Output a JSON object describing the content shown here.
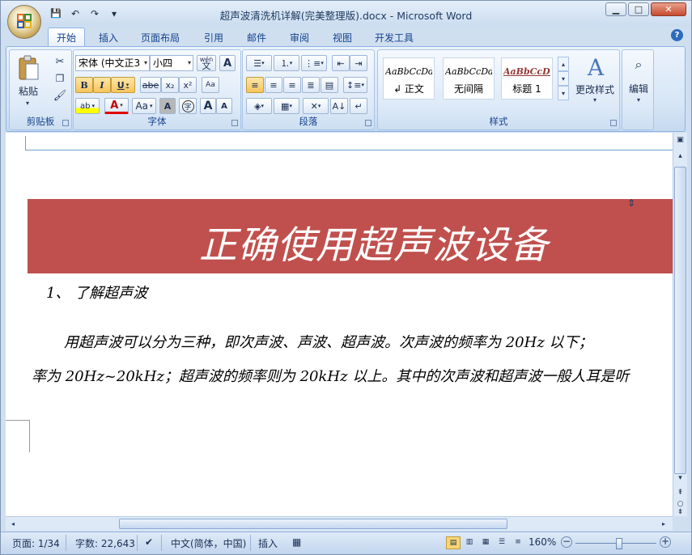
{
  "window": {
    "title": "超声波清洗机详解(完美整理版).docx - Microsoft Word",
    "controls": {
      "minimize": "▁",
      "maximize": "□",
      "close": "✕"
    }
  },
  "quick_access": {
    "save": "💾",
    "undo": "↶",
    "redo": "↷",
    "customize": "▾"
  },
  "tabs": [
    "开始",
    "插入",
    "页面布局",
    "引用",
    "邮件",
    "审阅",
    "视图",
    "开发工具"
  ],
  "help": "?",
  "ribbon": {
    "clipboard": {
      "label": "剪贴板",
      "paste": "粘贴"
    },
    "font": {
      "label": "字体",
      "font_name": "宋体 (中文正3",
      "font_size": "小四",
      "wen": "wén",
      "bold": "B",
      "italic": "I",
      "underline": "U",
      "strike": "abe",
      "sub": "x₂",
      "sup": "x²",
      "clear": "Aa",
      "highlight": "ab",
      "font_color": "A",
      "case": "Aa",
      "shade": "A",
      "circle": "字",
      "grow": "A",
      "shrink": "A"
    },
    "paragraph": {
      "label": "段落"
    },
    "styles": {
      "label": "样式",
      "items": [
        {
          "sample": "AaBbCcDdI",
          "name": "↲ 正文"
        },
        {
          "sample": "AaBbCcDdI",
          "name": "无间隔"
        },
        {
          "sample": "AaBbCcDd",
          "name": "标题 1"
        }
      ],
      "change_styles": "更改样式"
    },
    "editing": {
      "label": "编辑"
    }
  },
  "document": {
    "banner_title": "正确使用超声波设备",
    "heading": "1、  了解超声波",
    "para_line1": "用超声波可以分为三种，即次声波、声波、超声波。次声波的频率为 20Hz 以下；",
    "para_line2": "率为 20Hz~20kHz；超声波的频率则为 20kHz 以上。其中的次声波和超声波一般人耳是听"
  },
  "status": {
    "page": "页面: 1/34",
    "words": "字数: 22,643",
    "language": "中文(简体，中国)",
    "mode": "插入",
    "zoom": "160%"
  },
  "colors": {
    "banner": "#c0504d",
    "ribbon_border": "#8db2e3",
    "tab_text": "#15428b"
  }
}
